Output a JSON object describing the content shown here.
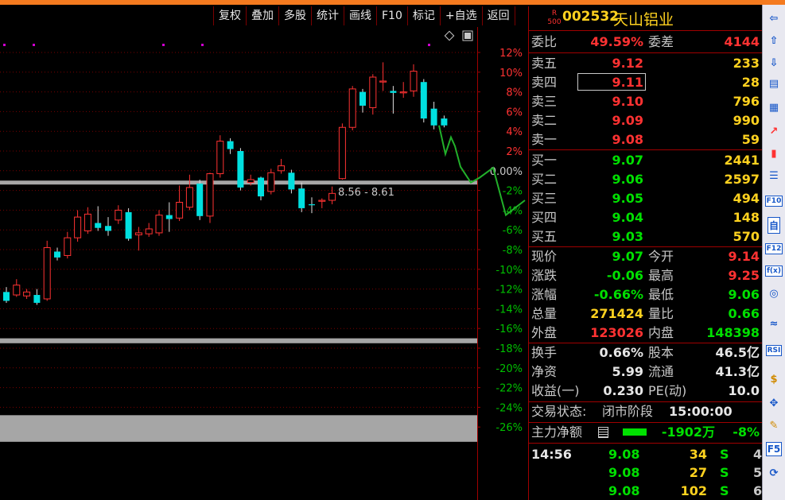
{
  "toolbar": {
    "buttons": [
      "复权",
      "叠加",
      "多股",
      "统计",
      "画线",
      "F10",
      "标记",
      "+自选",
      "返回"
    ]
  },
  "chart": {
    "price_range_label": "8.56 - 8.61",
    "y_axis_ticks": [
      "12%",
      "10%",
      "8%",
      "6%",
      "4%",
      "2%",
      "0.00%",
      "-2%",
      "-4%",
      "-6%",
      "-8%",
      "-10%",
      "-12%",
      "-14%",
      "-16%",
      "-18%",
      "-20%",
      "-22%",
      "-24%",
      "-26%"
    ]
  },
  "chart_data": {
    "type": "candlestick",
    "y_axis_ticks": [
      "12%",
      "10%",
      "8%",
      "6%",
      "4%",
      "2%",
      "0.00%",
      "-2%",
      "-4%",
      "-6%",
      "-8%",
      "-10%",
      "-12%",
      "-14%",
      "-16%",
      "-18%",
      "-20%",
      "-22%",
      "-24%",
      "-26%"
    ],
    "annotations": [
      "8.56 - 8.61"
    ],
    "candles": [
      {
        "o": -12.3,
        "c": -13.2,
        "h": -11.8,
        "l": -13.4
      },
      {
        "o": -12.6,
        "c": -11.6,
        "h": -11.0,
        "l": -12.8
      },
      {
        "o": -12.7,
        "c": -12.3,
        "h": -12.0,
        "l": -13.0
      },
      {
        "o": -12.6,
        "c": -13.4,
        "h": -12.0,
        "l": -13.6
      },
      {
        "o": -13.0,
        "c": -7.8,
        "h": -7.1,
        "l": -13.2
      },
      {
        "o": -8.2,
        "c": -8.8,
        "h": -7.8,
        "l": -9.1
      },
      {
        "o": -8.6,
        "c": -6.8,
        "h": -6.2,
        "l": -8.9
      },
      {
        "o": -6.8,
        "c": -4.7,
        "h": -4.0,
        "l": -7.2
      },
      {
        "o": -6.1,
        "c": -4.4,
        "h": -3.7,
        "l": -6.4
      },
      {
        "o": -5.3,
        "c": -5.8,
        "h": -3.6,
        "l": -6.1
      },
      {
        "o": -5.6,
        "c": -6.1,
        "h": -4.7,
        "l": -6.6
      },
      {
        "o": -5.0,
        "c": -4.0,
        "h": -3.5,
        "l": -5.4
      },
      {
        "o": -4.2,
        "c": -6.9,
        "h": -3.8,
        "l": -7.1
      },
      {
        "o": -6.5,
        "c": -6.3,
        "h": -5.7,
        "l": -8.1
      },
      {
        "o": -6.4,
        "c": -5.9,
        "h": -5.3,
        "l": -6.7
      },
      {
        "o": -6.3,
        "c": -4.5,
        "h": -4.0,
        "l": -6.6
      },
      {
        "o": -4.5,
        "c": -4.9,
        "h": -3.2,
        "l": -6.2
      },
      {
        "o": -4.8,
        "c": -3.2,
        "h": -1.5,
        "l": -5.1
      },
      {
        "o": -3.7,
        "c": -1.7,
        "h": -0.4,
        "l": -4.0
      },
      {
        "o": -1.3,
        "c": -4.6,
        "h": -0.9,
        "l": -5.0
      },
      {
        "o": -4.6,
        "c": -0.3,
        "h": -0.2,
        "l": -5.3
      },
      {
        "o": -0.3,
        "c": 3.0,
        "h": 3.6,
        "l": -0.7
      },
      {
        "o": 3.0,
        "c": 2.2,
        "h": 3.3,
        "l": 1.7
      },
      {
        "o": 2.0,
        "c": -1.7,
        "h": 2.3,
        "l": -2.0
      },
      {
        "o": -1.2,
        "c": -0.9,
        "h": -0.4,
        "l": -1.5
      },
      {
        "o": -0.7,
        "c": -2.6,
        "h": -0.6,
        "l": -3.0
      },
      {
        "o": -2.1,
        "c": -0.2,
        "h": 0.2,
        "l": -2.4
      },
      {
        "o": 0.0,
        "c": 0.5,
        "h": 1.2,
        "l": -0.3
      },
      {
        "o": -0.2,
        "c": -1.9,
        "h": 0.1,
        "l": -2.3
      },
      {
        "o": -1.8,
        "c": -3.8,
        "h": -1.2,
        "l": -4.2
      },
      {
        "o": -3.4,
        "c": -3.5,
        "h": -2.7,
        "l": -4.3
      },
      {
        "o": -3.1,
        "c": -3.0,
        "h": -2.8,
        "l": -3.8
      },
      {
        "o": -3.0,
        "c": -2.3,
        "h": -1.6,
        "l": -3.4
      },
      {
        "o": -0.8,
        "c": 4.4,
        "h": 4.8,
        "l": -0.9
      },
      {
        "o": 4.4,
        "c": 8.3,
        "h": 8.6,
        "l": 4.1
      },
      {
        "o": 8.0,
        "c": 6.6,
        "h": 8.3,
        "l": 5.9
      },
      {
        "o": 6.4,
        "c": 9.5,
        "h": 9.8,
        "l": 5.7
      },
      {
        "o": 9.0,
        "c": 9.1,
        "h": 11.0,
        "l": 8.1
      },
      {
        "o": 8.1,
        "c": 7.9,
        "h": 8.6,
        "l": 5.8
      },
      {
        "o": 7.9,
        "c": 8.0,
        "h": 9.0,
        "l": 7.4
      },
      {
        "o": 8.1,
        "c": 10.1,
        "h": 10.8,
        "l": 7.5
      },
      {
        "o": 9.0,
        "c": 5.3,
        "h": 9.3,
        "l": 4.9
      },
      {
        "o": 6.3,
        "c": 4.6,
        "h": 7.0,
        "l": 4.2
      },
      {
        "o": 5.3,
        "c": 4.6,
        "h": 5.6,
        "l": 4.4
      }
    ],
    "projection": [
      [
        5.0,
        4.0
      ],
      [
        2.0,
        3.2
      ],
      [
        -1.0,
        0.0
      ],
      [
        -2.0,
        -6.0
      ],
      [
        -3.0,
        -7.5
      ],
      [
        -5.0,
        -6.6
      ],
      [
        -12.5,
        -14.0
      ]
    ],
    "bands": [
      [
        -1.0,
        -1.4
      ],
      [
        -17.0,
        -17.5
      ],
      [
        -24.8,
        -27.5
      ]
    ]
  },
  "quote": {
    "badge_top": "R",
    "badge_bottom": "500",
    "code": "002532",
    "name": "天山铝业",
    "wei_bi_label": "委比",
    "wei_bi": "49.59%",
    "wei_cha_label": "委差",
    "wei_cha": "4144",
    "asks": [
      {
        "label": "卖五",
        "price": "9.12",
        "vol": "233"
      },
      {
        "label": "卖四",
        "price": "9.11",
        "vol": "28"
      },
      {
        "label": "卖三",
        "price": "9.10",
        "vol": "796"
      },
      {
        "label": "卖二",
        "price": "9.09",
        "vol": "990"
      },
      {
        "label": "卖一",
        "price": "9.08",
        "vol": "59"
      }
    ],
    "bids": [
      {
        "label": "买一",
        "price": "9.07",
        "vol": "2441"
      },
      {
        "label": "买二",
        "price": "9.06",
        "vol": "2597"
      },
      {
        "label": "买三",
        "price": "9.05",
        "vol": "494"
      },
      {
        "label": "买四",
        "price": "9.04",
        "vol": "148"
      },
      {
        "label": "买五",
        "price": "9.03",
        "vol": "570"
      }
    ],
    "stats": [
      {
        "l1": "现价",
        "v1": "9.07",
        "c1": "green",
        "l2": "今开",
        "v2": "9.14",
        "c2": "red"
      },
      {
        "l1": "涨跌",
        "v1": "-0.06",
        "c1": "green",
        "l2": "最高",
        "v2": "9.25",
        "c2": "red"
      },
      {
        "l1": "涨幅",
        "v1": "-0.66%",
        "c1": "green",
        "l2": "最低",
        "v2": "9.06",
        "c2": "green"
      },
      {
        "l1": "总量",
        "v1": "271424",
        "c1": "yellow",
        "l2": "量比",
        "v2": "0.66",
        "c2": "green"
      },
      {
        "l1": "外盘",
        "v1": "123026",
        "c1": "red",
        "l2": "内盘",
        "v2": "148398",
        "c2": "green"
      }
    ],
    "fundamentals": [
      {
        "l1": "换手",
        "v1": "0.66%",
        "l2": "股本",
        "v2": "46.5亿"
      },
      {
        "l1": "净资",
        "v1": "5.99",
        "l2": "流通",
        "v2": "41.3亿"
      },
      {
        "l1": "收益(一)",
        "v1": "0.230",
        "l2": "PE(动)",
        "v2": "10.0"
      }
    ],
    "status_label": "交易状态:",
    "status_value": "闭市阶段",
    "status_time": "15:00:00",
    "flow_label": "主力净额",
    "flow_value": "-1902万",
    "flow_pct": "-8%",
    "ticks": [
      {
        "time": "14:56",
        "price": "9.08",
        "qty": "34",
        "side": "S",
        "count": "4"
      },
      {
        "time": "",
        "price": "9.08",
        "qty": "27",
        "side": "S",
        "count": "5"
      },
      {
        "time": "",
        "price": "9.08",
        "qty": "102",
        "side": "S",
        "count": "6"
      }
    ]
  },
  "side_toolbar": {
    "icons": [
      "arrow-left-icon",
      "arrow-up-icon",
      "arrow-down-icon",
      "report-icon",
      "grid-icon",
      "trend-icon",
      "candle-icon",
      "list-icon",
      "f10-icon",
      "self-icon",
      "f12-icon",
      "fx-icon",
      "circle-icon",
      "wave-icon",
      "rsi-icon",
      "dollar-icon",
      "move-icon",
      "pencil-icon",
      "f5-icon",
      "refresh-icon"
    ],
    "labels": [
      "RSI",
      "F10",
      "自",
      "F12",
      "f(x)",
      "F5"
    ],
    "colors": {
      "accent": "#1656c8",
      "red": "#ff3232",
      "green": "#00e000"
    }
  }
}
